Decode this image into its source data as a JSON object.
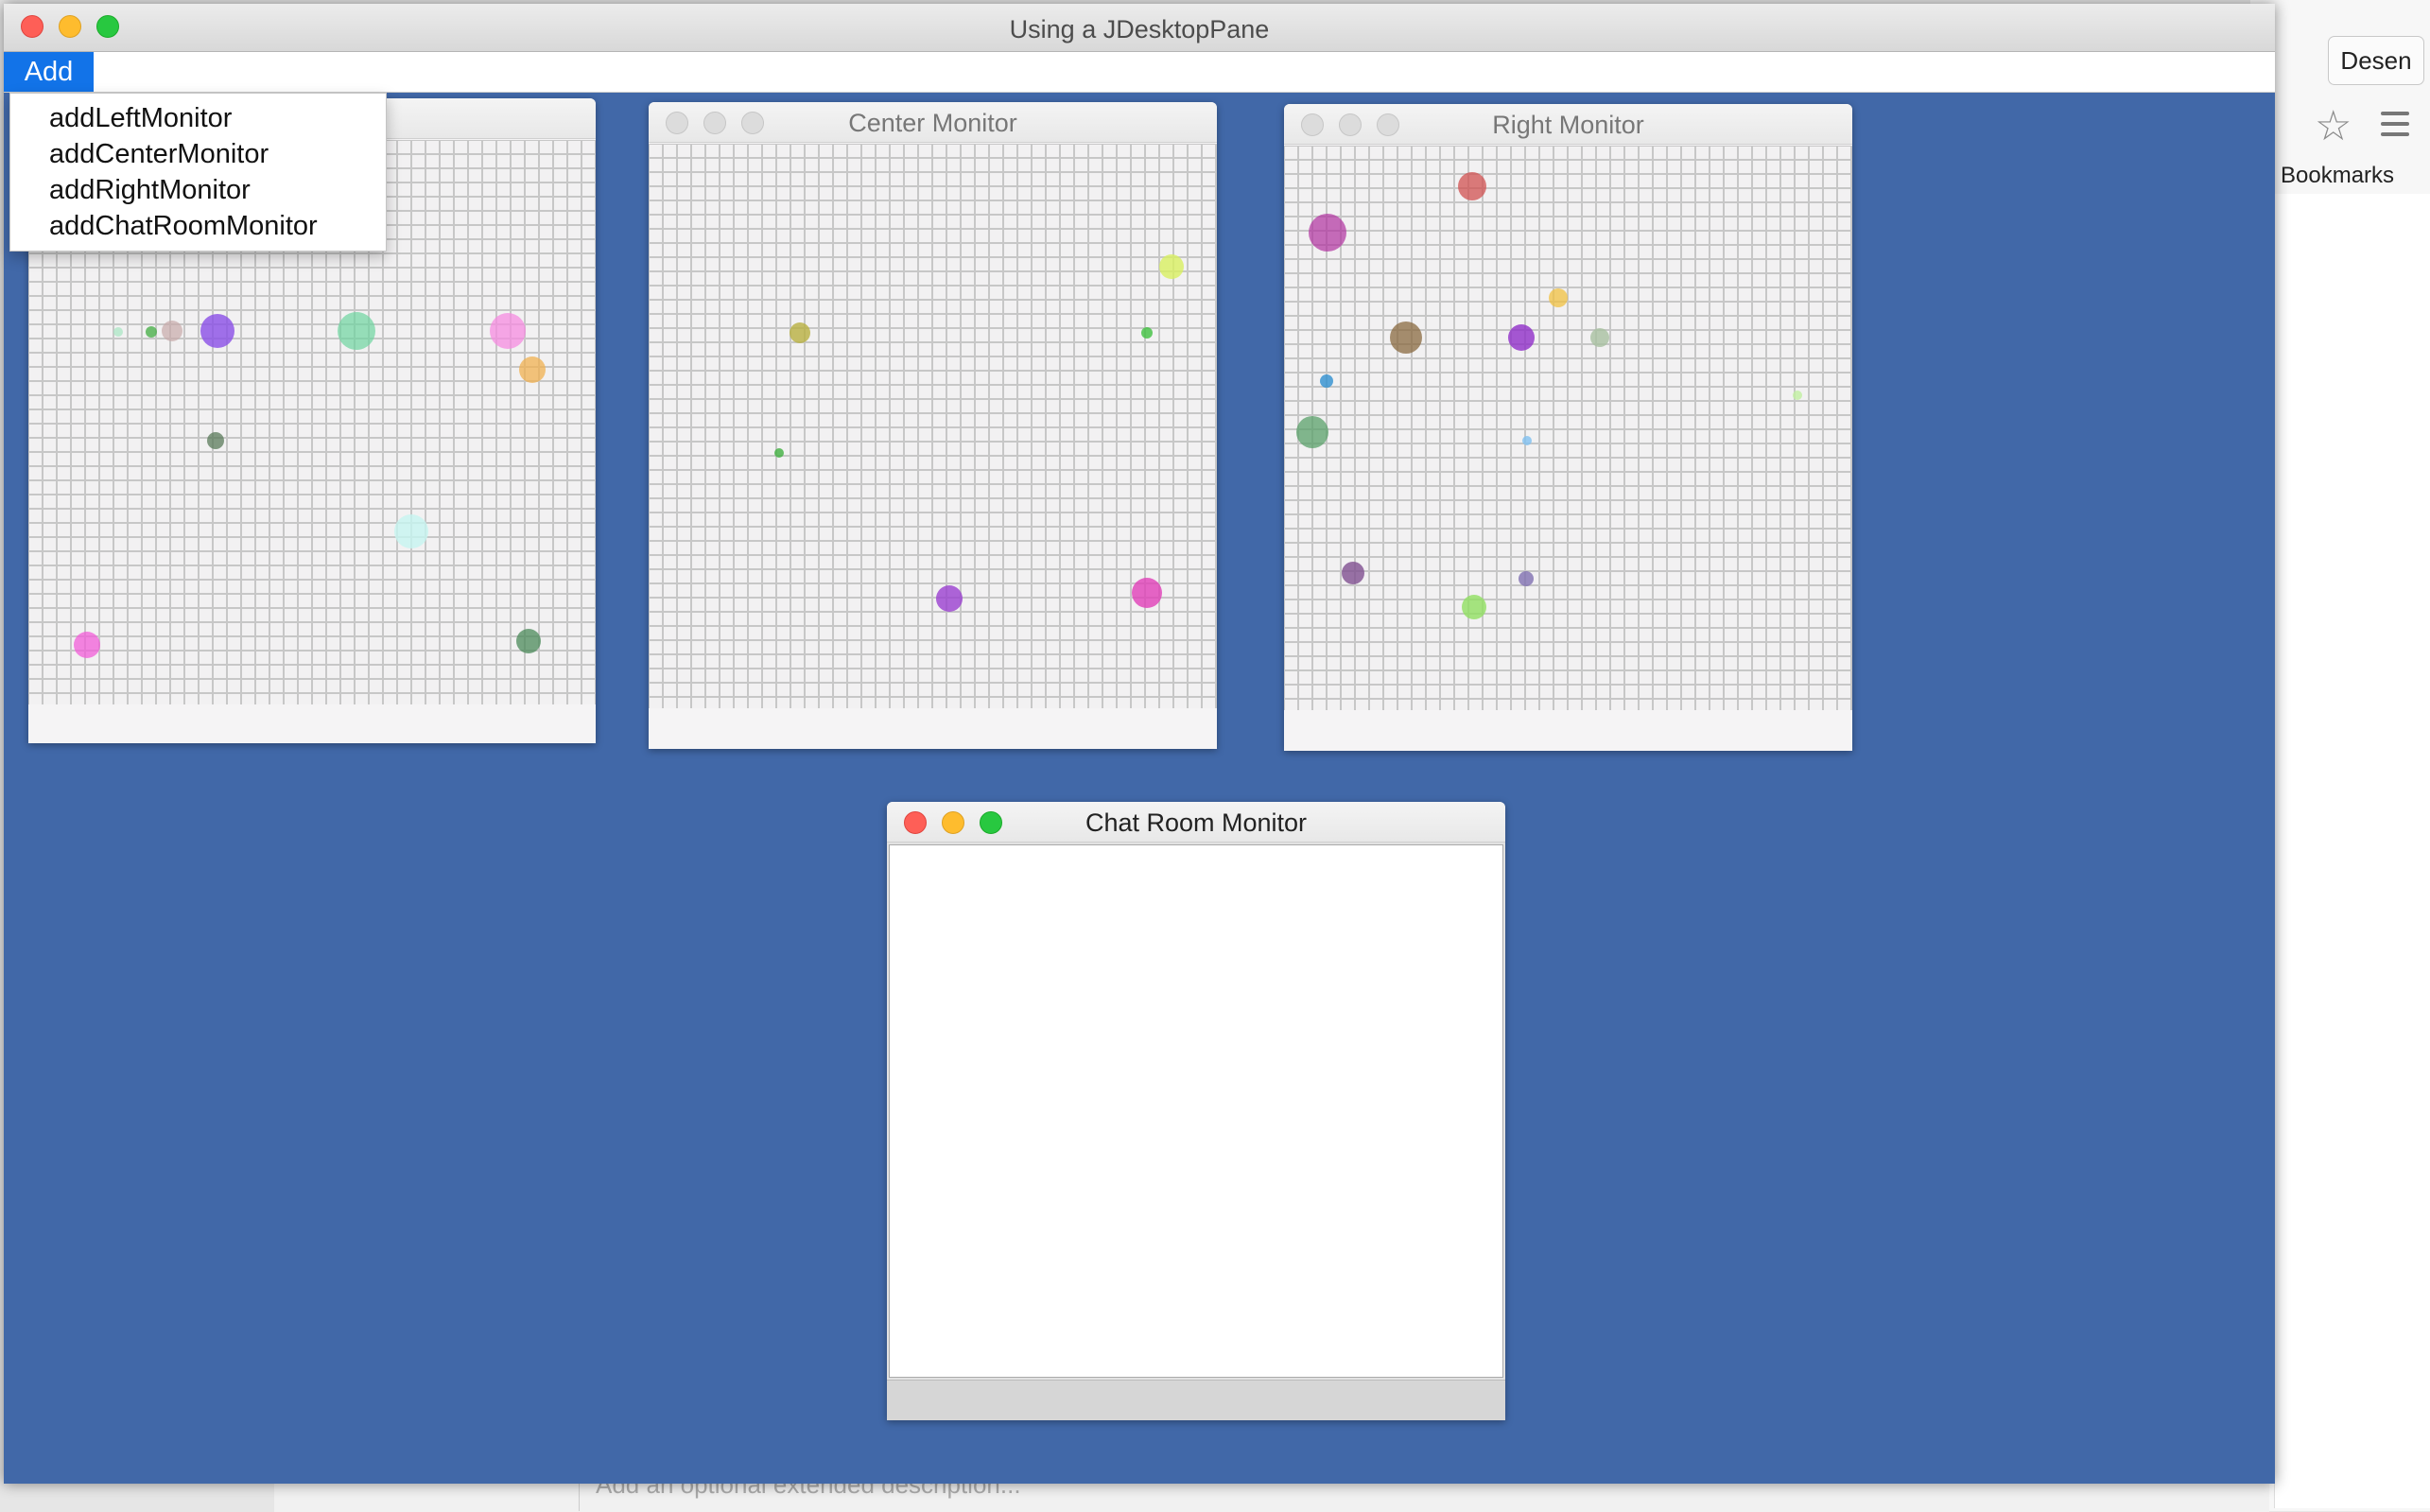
{
  "background_browser": {
    "button_label": "Desen",
    "bookmarks_label": "er Bookmarks",
    "description_placeholder": "Add an optional extended description..."
  },
  "app": {
    "title": "Using a JDesktopPane",
    "menu": {
      "add_label": "Add",
      "items": [
        "addLeftMonitor",
        "addCenterMonitor",
        "addRightMonitor",
        "addChatRoomMonitor"
      ]
    },
    "desktop_color": "#4168a8"
  },
  "frames": {
    "center_title": "Center Monitor",
    "right_title": "Right Monitor",
    "chat_title": "Chat Room Monitor"
  },
  "icons": {
    "star": "star-icon",
    "menu": "hamburger-menu-icon"
  }
}
